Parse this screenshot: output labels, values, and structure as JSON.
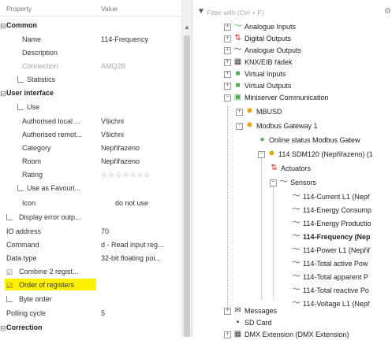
{
  "properties": {
    "header": {
      "property": "Property",
      "value": "Value"
    },
    "sections": {
      "common": "Common",
      "user_interface": "User interface",
      "correction": "Correction"
    },
    "rows": {
      "name": {
        "key": "Name",
        "value": "114-Frequency"
      },
      "description": {
        "key": "Description",
        "value": ""
      },
      "connection": {
        "key": "Connection",
        "value": "AMQ28"
      },
      "statistics": {
        "key": "Statistics"
      },
      "use": {
        "key": "Use"
      },
      "auth_local": {
        "key": "Authorised local ...",
        "value": "Všichni"
      },
      "auth_remote": {
        "key": "Authorised remot...",
        "value": "Všichni"
      },
      "category": {
        "key": "Category",
        "value": "Nepřiřazeno"
      },
      "room": {
        "key": "Room",
        "value": "Nepřiřazeno"
      },
      "rating": {
        "key": "Rating",
        "value": "☆☆☆☆☆☆☆"
      },
      "use_favourite": {
        "key": "Use as Favouri..."
      },
      "icon": {
        "key": "Icon",
        "value": "do not use"
      },
      "display_error": {
        "key": "Display error outp..."
      },
      "io_address": {
        "key": "IO address",
        "value": "70"
      },
      "command": {
        "key": "Command",
        "value": "d - Read input reg..."
      },
      "data_type": {
        "key": "Data type",
        "value": "32-bit floating poi..."
      },
      "combine": {
        "key": "Combine 2 regist..."
      },
      "order": {
        "key": "Order of registers"
      },
      "byte_order": {
        "key": "Byte order"
      },
      "polling": {
        "key": "Polling cycle",
        "value": "5"
      }
    }
  },
  "tree": {
    "filter_placeholder": "Filter with (Ctrl + F)",
    "items": {
      "analogue_inputs": "Analogue Inputs",
      "digital_outputs": "Digital Outputs",
      "analogue_outputs": "Analogue Outputs",
      "knx": "KNX/EIB řádek",
      "virtual_inputs": "Virtual Inputs",
      "virtual_outputs": "Virtual Outputs",
      "miniserver_comm": "Miniserver Communication",
      "mbusd": "MBUSD",
      "modbus_gateway": "Modbus Gateway 1",
      "online_status": "Online status Modbus Gatew",
      "sdm120": "114 SDM120 (Nepřiřazeno) (1",
      "actuators": "Actuators",
      "sensors": "Sensors",
      "current": "114-Current L1 (Nepř",
      "energy_consump": "114-Energy Consump",
      "energy_product": "114-Energy Productio",
      "frequency": "114-Frequency (Nep",
      "power": "114-Power L1 (Nepřiř",
      "total_active": "114-Total active Pow",
      "total_apparent": "114-Total apparent P",
      "total_reactive": "114-Total reactive Po",
      "voltage": "114-Voltage L1 (Nepř",
      "messages": "Messages",
      "sd_card": "SD Card",
      "dmx": "DMX Extension (DMX Extension)"
    }
  }
}
